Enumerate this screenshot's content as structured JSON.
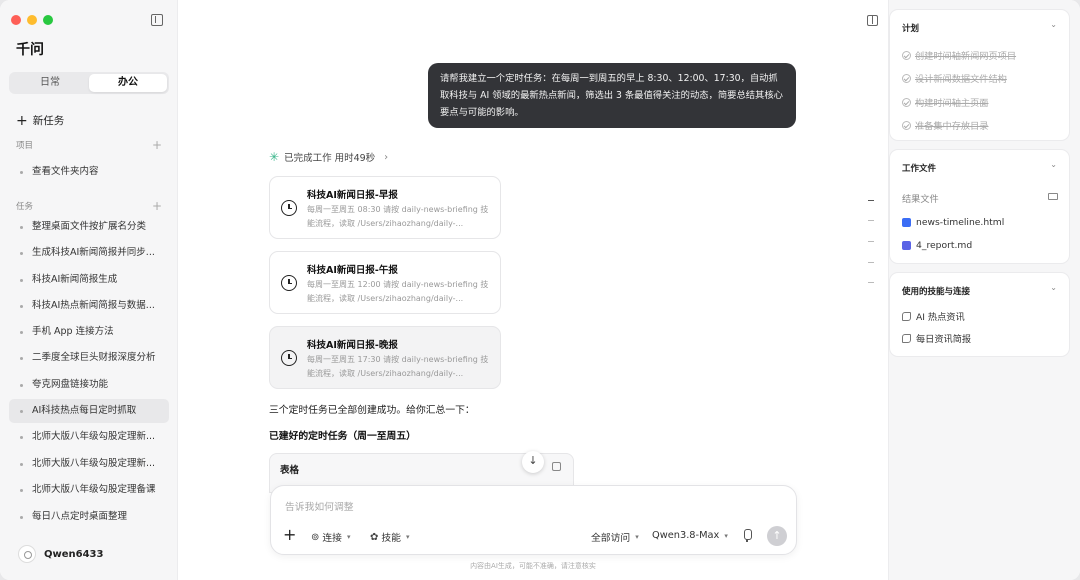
{
  "colors": {
    "close": "#fe5f57",
    "minimize": "#febc2e",
    "zoom": "#28c840",
    "accent": "#38b58a",
    "bubble": "#333438",
    "html_file": "#3b6df5",
    "md_file": "#5a63e6"
  },
  "sidebar": {
    "title": "千问",
    "segments": [
      {
        "label": "日常",
        "active": false
      },
      {
        "label": "办公",
        "active": true
      }
    ],
    "new_task": "新任务",
    "projects_label": "项目",
    "projects": [
      {
        "label": "查看文件夹内容"
      }
    ],
    "tasks_label": "任务",
    "tasks": [
      {
        "label": "整理桌面文件按扩展名分类"
      },
      {
        "label": "生成科技AI新闻简报并同步..."
      },
      {
        "label": "科技AI新闻简报生成"
      },
      {
        "label": "科技AI热点新闻简报与数据..."
      },
      {
        "label": "手机 App 连接方法"
      },
      {
        "label": "二季度全球巨头财报深度分析"
      },
      {
        "label": "夸克网盘链接功能"
      },
      {
        "label": "AI科技热点每日定时抓取",
        "active": true
      },
      {
        "label": "北师大版八年级勾股定理新..."
      },
      {
        "label": "北师大版八年级勾股定理新..."
      },
      {
        "label": "北师大版八年级勾股定理备课"
      },
      {
        "label": "每日八点定时桌面整理"
      }
    ],
    "user_name": "Qwen6433"
  },
  "chat": {
    "user_message": "请帮我建立一个定时任务：在每周一到周五的早上 8:30、12:00、17:30，自动抓取科技与 AI 领域的最新热点新闻，筛选出 3 条最值得关注的动态，简要总结其核心要点与可能的影响。",
    "done_status": "已完成工作 用时49秒",
    "cards": [
      {
        "title": "科技AI新闻日报-早报",
        "desc": "每周一至周五 08:30   请按 daily-news-briefing 技能流程，读取 /Users/zihaozhang/daily-..."
      },
      {
        "title": "科技AI新闻日报-午报",
        "desc": "每周一至周五 12:00   请按 daily-news-briefing 技能流程，读取 /Users/zihaozhang/daily-..."
      },
      {
        "title": "科技AI新闻日报-晚报",
        "desc": "每周一至周五 17:30   请按 daily-news-briefing 技能流程，读取 /Users/zihaozhang/daily-..."
      }
    ],
    "summary": "三个定时任务已全部创建成功。给你汇总一下：",
    "summary_heading": "已建好的定时任务（周一至周五）",
    "table_label": "表格"
  },
  "composer": {
    "placeholder": "告诉我如何调整",
    "connect_label": "连接",
    "skills_label": "技能",
    "access_label": "全部访问",
    "model_label": "Qwen3.8-Max"
  },
  "disclaimer": "内容由AI生成，可能不准确，请注意核实",
  "panel": {
    "plan_title": "计划",
    "plan_items": [
      "创建时间轴新闻网页项目",
      "设计新闻数据文件结构",
      "构建时间轴主页面",
      "准备集中存放目录"
    ],
    "files_title": "工作文件",
    "result_files_label": "结果文件",
    "files": [
      {
        "name": "news-timeline.html",
        "icon": "html-file-icon"
      },
      {
        "name": "4_report.md",
        "icon": "markdown-file-icon"
      }
    ],
    "skills_title": "使用的技能与连接",
    "skills": [
      "AI 热点资讯",
      "每日资讯简报"
    ]
  }
}
